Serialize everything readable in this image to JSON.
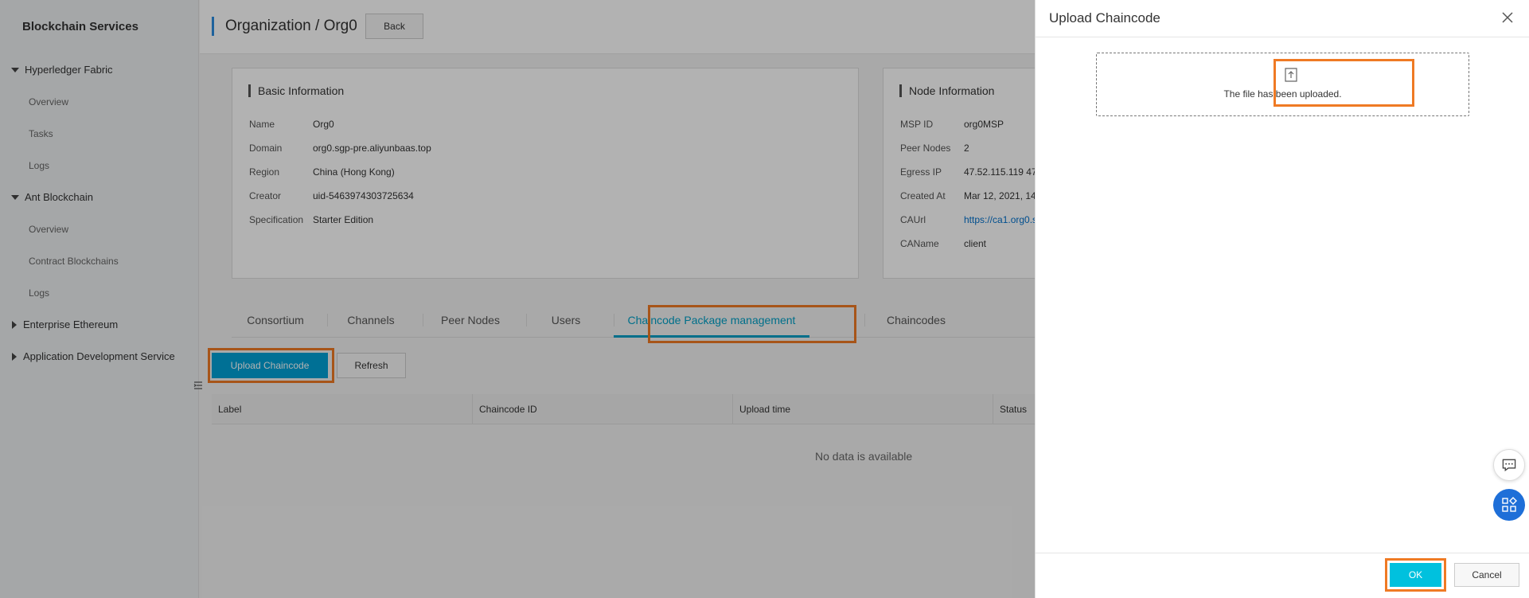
{
  "sidebar": {
    "brand": "Blockchain Services",
    "groups": [
      {
        "label": "Hyperledger Fabric",
        "items": [
          "Overview",
          "Tasks",
          "Logs"
        ]
      },
      {
        "label": "Ant Blockchain",
        "items": [
          "Overview",
          "Contract Blockchains",
          "Logs"
        ]
      },
      {
        "label": "Enterprise Ethereum"
      },
      {
        "label": "Application Development Service"
      }
    ]
  },
  "header": {
    "title": "Organization / Org0",
    "back_label": "Back"
  },
  "basic_info": {
    "title": "Basic Information",
    "rows": [
      {
        "k": "Name",
        "v": "Org0"
      },
      {
        "k": "Domain",
        "v": "org0.sgp-pre.aliyunbaas.top"
      },
      {
        "k": "Region",
        "v": "China (Hong Kong)"
      },
      {
        "k": "Creator",
        "v": "uid-5463974303725634"
      },
      {
        "k": "Specification",
        "v": "Starter Edition"
      }
    ]
  },
  "node_info": {
    "title": "Node Information",
    "rows": [
      {
        "k": "MSP ID",
        "v": "org0MSP"
      },
      {
        "k": "Peer Nodes",
        "v": "2"
      },
      {
        "k": "Egress IP",
        "v": "47.52.115.119 47"
      },
      {
        "k": "Created At",
        "v": "Mar 12, 2021, 14"
      },
      {
        "k": "CAUrl",
        "v": "https://ca1.org0.s"
      },
      {
        "k": "CAName",
        "v": "client"
      }
    ]
  },
  "tabs": [
    "Consortium",
    "Channels",
    "Peer Nodes",
    "Users",
    "Chaincode Package management",
    "Chaincodes"
  ],
  "toolbar": {
    "upload_label": "Upload Chaincode",
    "refresh_label": "Refresh"
  },
  "table": {
    "columns": [
      "Label",
      "Chaincode ID",
      "Upload time",
      "Status"
    ],
    "empty_text": "No data is available"
  },
  "drawer": {
    "title": "Upload Chaincode",
    "upload_status": "The file has been uploaded.",
    "ok_label": "OK",
    "cancel_label": "Cancel"
  },
  "colors": {
    "accent": "#00a1d6",
    "highlight": "#ef7a24",
    "ok": "#00c1de"
  }
}
